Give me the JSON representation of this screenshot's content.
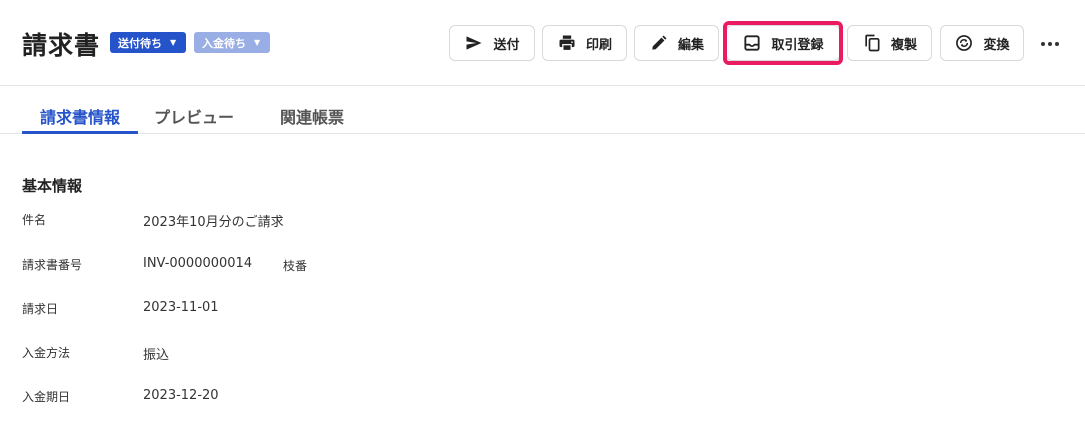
{
  "header": {
    "title": "請求書",
    "badges": [
      {
        "label": "送付待ち",
        "color": "#2553c9"
      },
      {
        "label": "入金待ち",
        "color": "#9aaee6"
      }
    ],
    "actions": {
      "send": "送付",
      "print": "印刷",
      "edit": "編集",
      "register": "取引登録",
      "copy": "複製",
      "convert": "変換"
    },
    "highlight_color": "#ea1a63"
  },
  "tabs": [
    {
      "label": "請求書情報",
      "active": true
    },
    {
      "label": "プレビュー",
      "active": false
    },
    {
      "label": "関連帳票",
      "active": false
    }
  ],
  "basic_info": {
    "section_title": "基本情報",
    "rows": [
      {
        "label": "件名",
        "value": "2023年10月分のご請求"
      },
      {
        "label": "請求書番号",
        "value": "INV-0000000014",
        "extra": "枝番"
      },
      {
        "label": "請求日",
        "value": "2023-11-01"
      },
      {
        "label": "入金方法",
        "value": "振込"
      },
      {
        "label": "入金期日",
        "value": "2023-12-20"
      }
    ]
  },
  "colors": {
    "accent": "#2553c9",
    "border": "#d9d9d9"
  }
}
